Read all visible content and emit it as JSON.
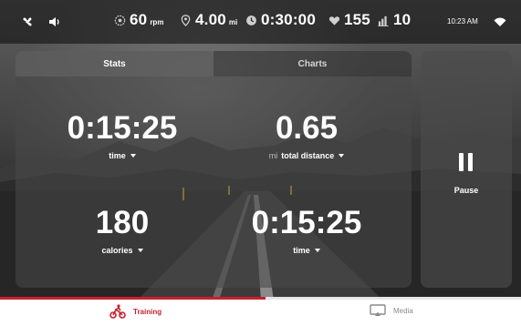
{
  "status_bar": {
    "rpm": {
      "value": "60",
      "unit": "rpm",
      "icon": "cadence-icon"
    },
    "distance": {
      "value": "4.00",
      "unit": "mi",
      "icon": "location-pin-icon"
    },
    "elapsed": {
      "value": "0:30:00",
      "icon": "clock-icon"
    },
    "heart_rate": {
      "value": "155",
      "icon": "heart-icon"
    },
    "resistance": {
      "value": "10",
      "icon": "resistance-bars-icon"
    },
    "time": "10:23 AM",
    "left_icons": [
      "fan-icon",
      "volume-icon"
    ],
    "right_icon": "wifi-icon"
  },
  "tabs": [
    {
      "label": "Stats",
      "active": true
    },
    {
      "label": "Charts",
      "active": false
    }
  ],
  "stats": [
    {
      "value": "0:15:25",
      "label": "time",
      "prefix": ""
    },
    {
      "value": "0.65",
      "label": "total distance",
      "prefix": "mi"
    },
    {
      "value": "180",
      "label": "calories",
      "prefix": ""
    },
    {
      "value": "0:15:25",
      "label": "time",
      "prefix": ""
    }
  ],
  "pause_label": "Pause",
  "bottom_tabs": [
    {
      "label": "Training",
      "icon": "bike-icon",
      "active": true
    },
    {
      "label": "Media",
      "icon": "media-cast-icon",
      "active": false
    }
  ],
  "workout_progress": 0.51,
  "colors": {
    "accent": "#c8202f"
  }
}
